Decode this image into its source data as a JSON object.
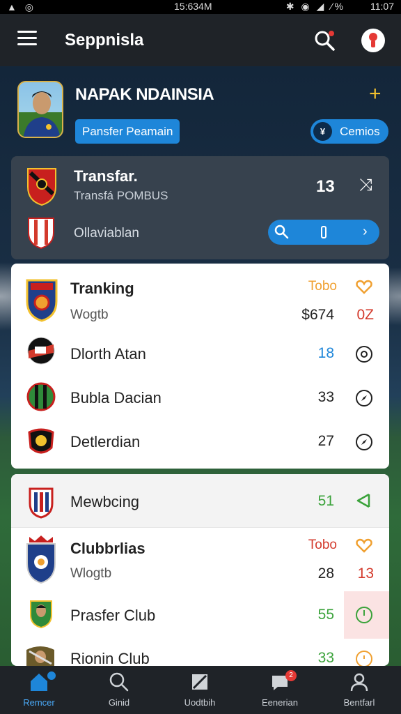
{
  "status_bar": {
    "left": "▲ ◎",
    "time": "15:634M",
    "right": "11:07",
    "icons": "✱ ◉ ◢ ∕%"
  },
  "app_bar": {
    "title": "Seppnisla"
  },
  "profile": {
    "name": "NAPAK NDAINSIA",
    "chip_label": "Pansfer Peamain",
    "pill_icon_text": "¥",
    "pill_label": "Cemios"
  },
  "transfer_card": {
    "title": "Transfar.",
    "subtitle": "Transfá POMBUS",
    "number": "13",
    "club_label": "Ollaviablan"
  },
  "card1": {
    "header": {
      "name": "Tranking",
      "sub": "Wogtb",
      "col_label": "Tobo",
      "col_value": "$674",
      "col_value2": "0Z"
    },
    "rows": [
      {
        "name": "Dlorth Atan",
        "value": "18",
        "value_color": "#1e86d9"
      },
      {
        "name": "Bubla Dacian",
        "value": "33",
        "value_color": "#222222"
      },
      {
        "name": "Detlerdian",
        "value": "27",
        "value_color": "#222222"
      }
    ]
  },
  "card2": {
    "top_row": {
      "name": "Mewbcing",
      "value": "51",
      "value_color": "#3aa23a"
    },
    "header": {
      "name": "Clubbrlias",
      "sub": "Wlogtb",
      "col_label": "Tobo",
      "col_value": "28",
      "col_value2": "13"
    },
    "rows": [
      {
        "name": "Prasfer Club",
        "value": "55",
        "value_color": "#3aa23a"
      },
      {
        "name": "Rionin Club",
        "value": "33",
        "value_color": "#3aa23a"
      }
    ]
  },
  "bottom_nav": [
    {
      "label": "Remcer",
      "icon": "home-icon",
      "active": true
    },
    {
      "label": "Ginid",
      "icon": "search-icon",
      "active": false
    },
    {
      "label": "Uodtbih",
      "icon": "flag-icon",
      "active": false
    },
    {
      "label": "Eenerian",
      "icon": "chat-icon",
      "active": false,
      "badge": "2"
    },
    {
      "label": "Bentfarl",
      "icon": "person-icon",
      "active": false
    }
  ],
  "colors": {
    "accent": "#1e86d9",
    "gold": "#f2c12e",
    "orange": "#f0a030",
    "red": "#d33a2c",
    "green": "#3aa23a"
  }
}
